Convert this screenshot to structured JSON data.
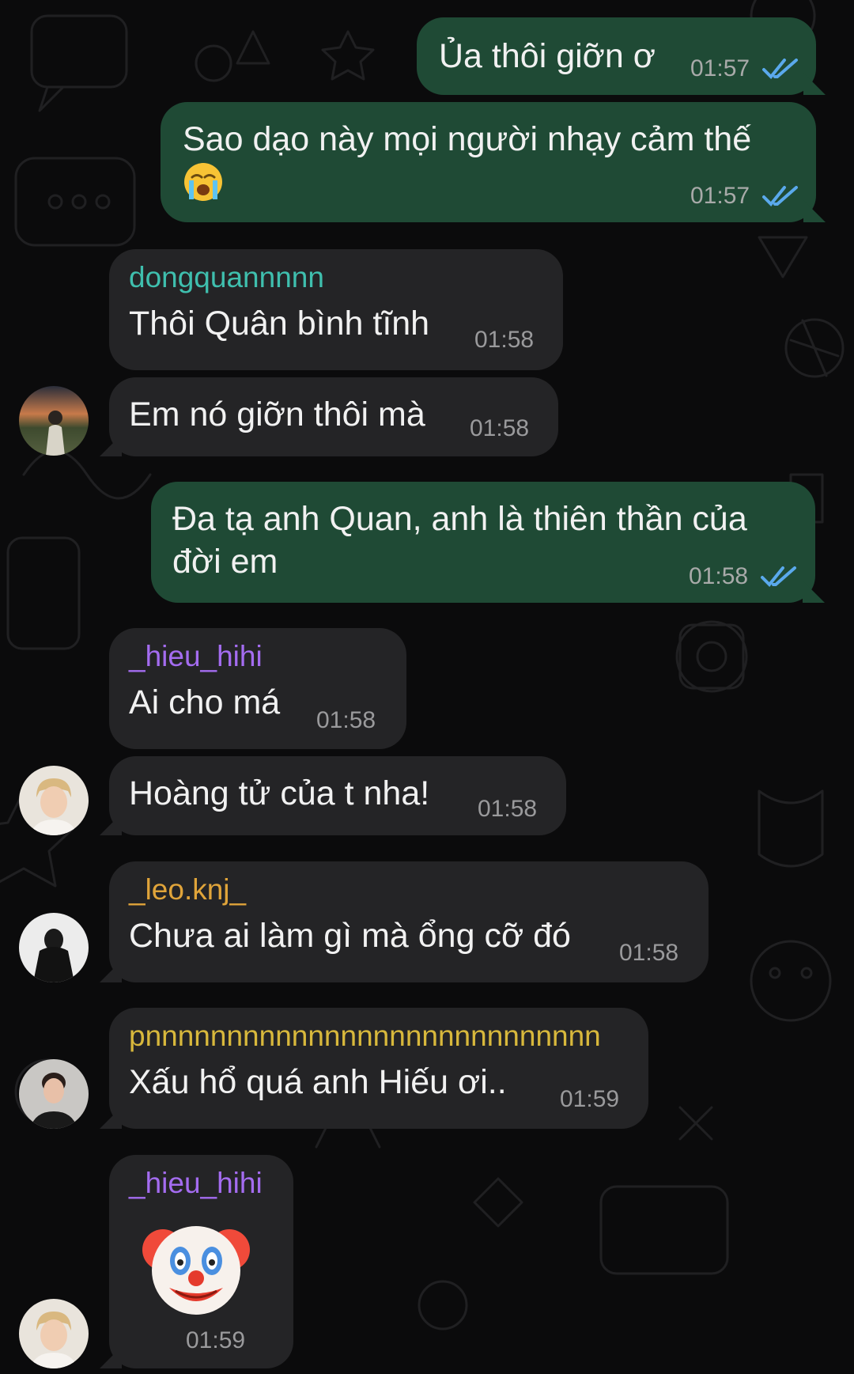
{
  "colors": {
    "background": "#0b0b0c",
    "outgoing_bubble": "#1f4a35",
    "incoming_bubble": "#242426",
    "read_check": "#5aa9ec",
    "sender_teal": "#3fbfae",
    "sender_purple": "#a46cf0",
    "sender_gold": "#e0a43a",
    "sender_yellow": "#d8b83c"
  },
  "messages": [
    {
      "direction": "outgoing",
      "text": "Ủa thôi giỡn ơ",
      "time": "01:57",
      "status": "read-double-check"
    },
    {
      "direction": "outgoing",
      "text_line1": "Sao dạo này mọi người nhạy cảm thế",
      "emoji": "loudly-crying-face",
      "time": "01:57",
      "status": "read-double-check"
    },
    {
      "direction": "incoming",
      "sender": "dongquannnnn",
      "text": "Thôi Quân bình tĩnh",
      "time": "01:58"
    },
    {
      "direction": "incoming",
      "text": "Em nó giỡn thôi mà",
      "time": "01:58",
      "avatar": "user-avatar-dongquan"
    },
    {
      "direction": "outgoing",
      "text_line1": "Đa tạ anh Quan, anh là thiên thần của",
      "text_line2": "đời em",
      "time": "01:58",
      "status": "read-double-check"
    },
    {
      "direction": "incoming",
      "sender": "_hieu_hihi",
      "text": "Ai cho má",
      "time": "01:58"
    },
    {
      "direction": "incoming",
      "text": "Hoàng tử của t nha!",
      "time": "01:58",
      "avatar": "user-avatar-hieu"
    },
    {
      "direction": "incoming",
      "sender": "_leo.knj_",
      "text": "Chưa ai làm gì mà ổng cỡ đó",
      "time": "01:58",
      "avatar": "user-avatar-leo"
    },
    {
      "direction": "incoming",
      "sender": "pnnnnnnnnnnnnnnnnnnnnnnnnnnnn",
      "text": "Xấu hổ quá anh Hiếu ơi..",
      "time": "01:59",
      "avatar": "user-avatar-pn"
    },
    {
      "direction": "incoming",
      "sender": "_hieu_hihi",
      "emoji": "clown-face",
      "time": "01:59",
      "avatar": "user-avatar-hieu"
    }
  ]
}
